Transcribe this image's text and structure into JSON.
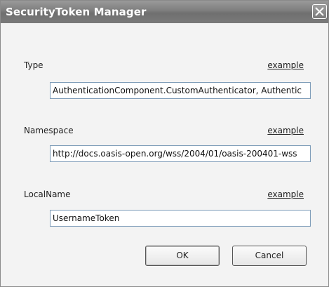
{
  "window": {
    "title": "SecurityToken Manager"
  },
  "fields": [
    {
      "label": "Type",
      "link": "example",
      "value": "AuthenticationComponent.CustomAuthenticator, Authentic"
    },
    {
      "label": "Namespace",
      "link": "example",
      "value": "http://docs.oasis-open.org/wss/2004/01/oasis-200401-wss"
    },
    {
      "label": "LocalName",
      "link": "example",
      "value": "UsernameToken"
    }
  ],
  "buttons": {
    "ok": "OK",
    "cancel": "Cancel"
  },
  "icons": {
    "close": "close-icon"
  }
}
